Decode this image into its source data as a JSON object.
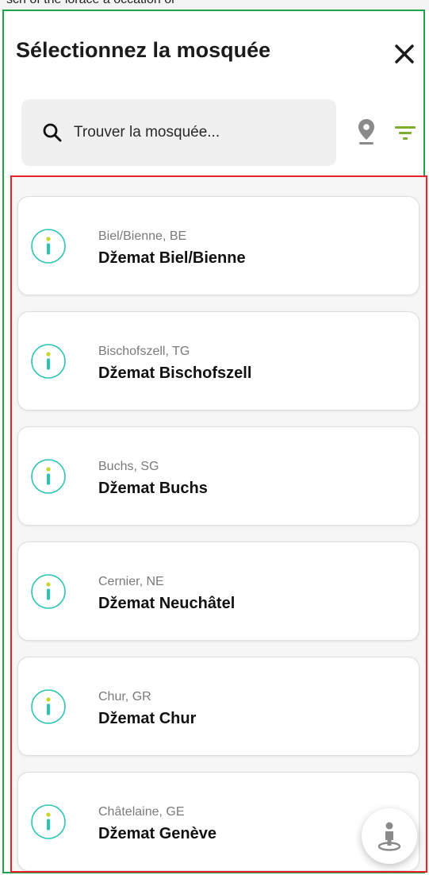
{
  "top_strip_text": "sch of the lorace a occation or",
  "header": {
    "title": "Sélectionnez la mosquée"
  },
  "search": {
    "placeholder": "Trouver la mosquée..."
  },
  "colors": {
    "accent": "#2bc4b4",
    "info_dot": "#c6d62a",
    "filter": "#7fae2e",
    "location": "#8a8a8a",
    "frame_green": "#1fa34a",
    "frame_red": "#e8232a"
  },
  "icons": {
    "close": "close-icon",
    "search": "search-icon",
    "location": "location-pin-icon",
    "filter": "filter-icon",
    "info": "info-icon",
    "fab": "person-location-icon"
  },
  "mosques": [
    {
      "location": "Biel/Bienne, BE",
      "name": "Džemat Biel/Bienne"
    },
    {
      "location": "Bischofszell, TG",
      "name": "Džemat Bischofszell"
    },
    {
      "location": "Buchs, SG",
      "name": "Džemat Buchs"
    },
    {
      "location": "Cernier, NE",
      "name": "Džemat Neuchâtel"
    },
    {
      "location": "Chur, GR",
      "name": "Džemat Chur"
    },
    {
      "location": "Châtelaine, GE",
      "name": "Džemat Genève"
    }
  ]
}
